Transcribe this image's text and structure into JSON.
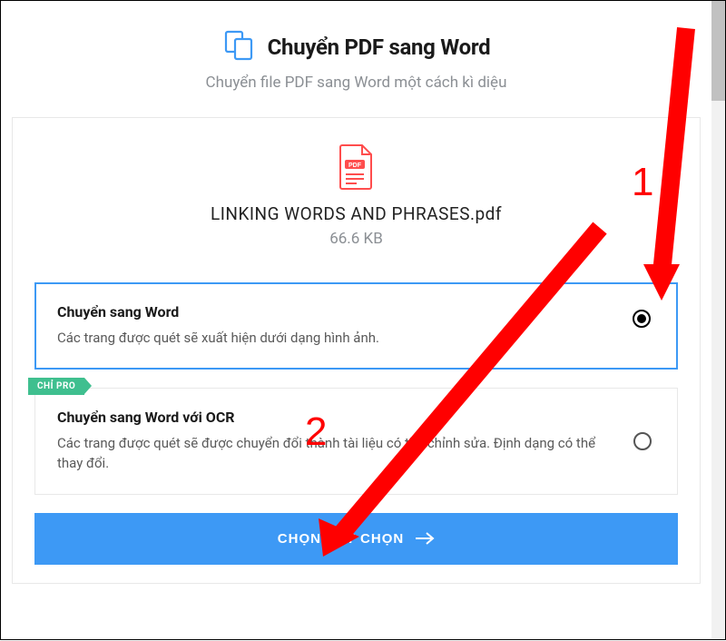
{
  "header": {
    "title": "Chuyển PDF sang Word",
    "subtitle": "Chuyển file PDF sang Word một cách kì diệu"
  },
  "file": {
    "name": "LINKING WORDS AND PHRASES.pdf",
    "size": "66.6 KB",
    "icon_label": "PDF"
  },
  "options": [
    {
      "title": "Chuyển sang Word",
      "desc": "Các trang được quét sẽ xuất hiện dưới dạng hình ảnh.",
      "selected": true
    },
    {
      "title": "Chuyển sang Word với OCR",
      "desc": "Các trang được quét sẽ được chuyển đổi thành tài liệu có thể chỉnh sửa. Định dạng có thể thay đổi.",
      "selected": false,
      "badge": "CHỈ PRO"
    }
  ],
  "cta": {
    "label": "CHỌN TÙY CHỌN"
  },
  "annotations": {
    "n1": "1",
    "n2": "2"
  },
  "colors": {
    "accent": "#3d99f5",
    "badge": "#3fbf8f",
    "annotation": "#ff0000",
    "muted": "#8b8f94"
  }
}
